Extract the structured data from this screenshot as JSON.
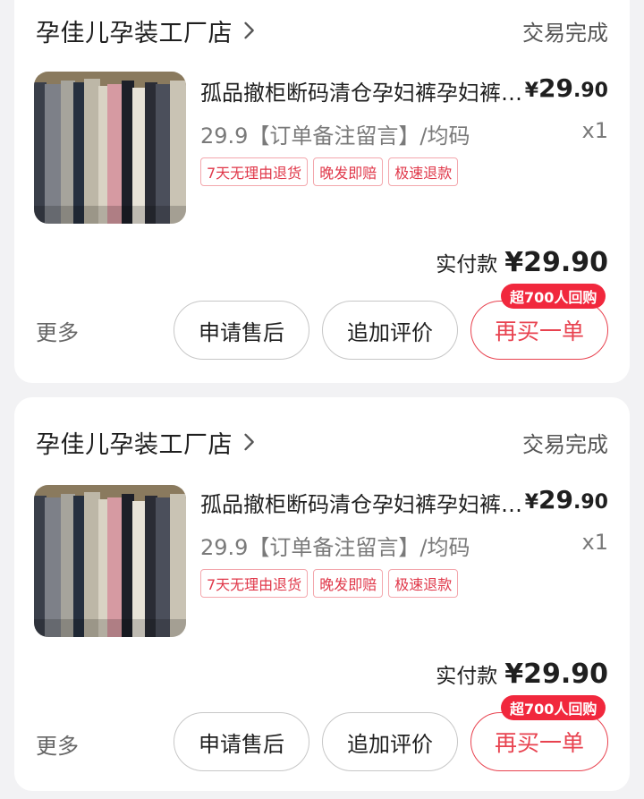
{
  "orders": [
    {
      "shop_name": "孕佳儿孕装工厂店",
      "status": "交易完成",
      "product": {
        "title": "孤品撤柜断码清仓孕妇裤孕妇裤孕妇裤",
        "price_currency": "¥",
        "price_int": "29",
        "price_dec": ".90",
        "sku": "29.9【订单备注留言】/均码",
        "qty": "x1",
        "tags": [
          "7天无理由退货",
          "晚发即赔",
          "极速退款"
        ]
      },
      "paid_label": "实付款",
      "paid_amount": "¥29.90",
      "more_label": "更多",
      "buttons": {
        "after_sales": "申请售后",
        "add_review": "追加评价",
        "rebuy": "再买一单"
      },
      "rebuy_badge": "超700人回购"
    },
    {
      "shop_name": "孕佳儿孕装工厂店",
      "status": "交易完成",
      "product": {
        "title": "孤品撤柜断码清仓孕妇裤孕妇裤孕妇裤",
        "price_currency": "¥",
        "price_int": "29",
        "price_dec": ".90",
        "sku": "29.9【订单备注留言】/均码",
        "qty": "x1",
        "tags": [
          "7天无理由退货",
          "晚发即赔",
          "极速退款"
        ]
      },
      "paid_label": "实付款",
      "paid_amount": "¥29.90",
      "more_label": "更多",
      "buttons": {
        "after_sales": "申请售后",
        "add_review": "追加评价",
        "rebuy": "再买一单"
      },
      "rebuy_badge": "超700人回购"
    }
  ],
  "icons": {
    "shop_chevron": "chevron-right-icon"
  },
  "colors": {
    "accent": "#e8424f",
    "badge_bg": "#f1283d",
    "tag_border": "#f3a7ad",
    "tag_text": "#e0384a"
  }
}
